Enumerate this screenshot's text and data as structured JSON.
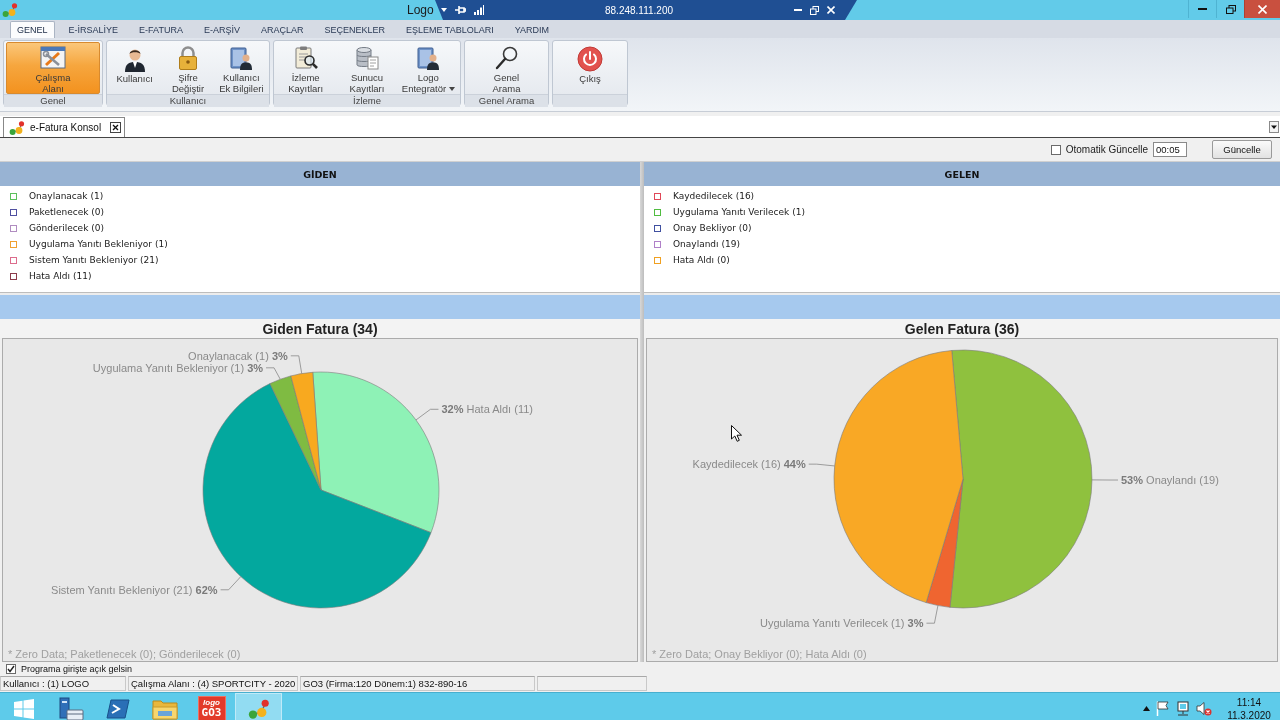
{
  "title_bar": {
    "title": "Logo"
  },
  "remote_bar": {
    "address": "88.248.111.200"
  },
  "ribbon": {
    "tabs": [
      {
        "label": "GENEL",
        "selected": true
      },
      {
        "label": "E-İRSALİYE",
        "selected": false
      },
      {
        "label": "E-FATURA",
        "selected": false
      },
      {
        "label": "E-ARŞİV",
        "selected": false
      },
      {
        "label": "ARAÇLAR",
        "selected": false
      },
      {
        "label": "SEÇENEKLER",
        "selected": false
      },
      {
        "label": "EŞLEME TABLOLARI",
        "selected": false
      },
      {
        "label": "YARDIM",
        "selected": false
      }
    ],
    "groups": [
      {
        "label": "Genel",
        "buttons": [
          {
            "lines": [
              "Çalışma",
              "Alanı"
            ],
            "selected": true,
            "dropdown": false
          }
        ]
      },
      {
        "label": "Kullanıcı",
        "buttons": [
          {
            "lines": [
              "Kullanıcı"
            ],
            "selected": false,
            "dropdown": false
          },
          {
            "lines": [
              "Şifre",
              "Değiştir"
            ],
            "selected": false,
            "dropdown": false
          },
          {
            "lines": [
              "Kullanıcı",
              "Ek Bilgileri"
            ],
            "selected": false,
            "dropdown": false
          }
        ]
      },
      {
        "label": "İzleme",
        "buttons": [
          {
            "lines": [
              "İzleme",
              "Kayıtları"
            ],
            "selected": false,
            "dropdown": false
          },
          {
            "lines": [
              "Sunucu",
              "Kayıtları"
            ],
            "selected": false,
            "dropdown": false
          },
          {
            "lines": [
              "Logo",
              "Entegratör"
            ],
            "selected": false,
            "dropdown": true
          }
        ]
      },
      {
        "label": "Genel Arama",
        "buttons": [
          {
            "lines": [
              "Genel",
              "Arama"
            ],
            "selected": false,
            "dropdown": false
          }
        ]
      },
      {
        "buttons": [
          {
            "lines": [
              "Çıkış"
            ],
            "selected": false,
            "dropdown": false
          }
        ]
      }
    ]
  },
  "document_tabs": [
    {
      "label": "e-Fatura Konsol",
      "selected": true
    }
  ],
  "toolbar": {
    "auto_update": {
      "label": "Otomatik Güncelle",
      "checked": false
    },
    "interval": {
      "value": "00:05"
    },
    "refresh_button": "Güncelle"
  },
  "panels": [
    {
      "header": "GİDEN",
      "items": [
        {
          "label": "Onaylanacak (1)",
          "color": "#5cc05c"
        },
        {
          "label": "Paketlenecek (0)",
          "color": "#5050a0"
        },
        {
          "label": "Gönderilecek (0)",
          "color": "#b08cc0"
        },
        {
          "label": "Uygulama Yanıtı Bekleniyor (1)",
          "color": "#f0a030"
        },
        {
          "label": "Sistem Yanıtı Bekleniyor (21)",
          "color": "#dc6c8c"
        },
        {
          "label": "Hata Aldı (11)",
          "color": "#8c3c4c"
        }
      ],
      "chart_data": {
        "type": "pie",
        "title": "Giden Fatura (34)",
        "categories": [
          "Hata Aldı (11)",
          "Sistem Yanıtı Bekleniyor (21)",
          "Uygulama Yanıtı Bekleniyor (1)",
          "Onaylanacak (1)"
        ],
        "values": [
          32,
          62,
          3,
          3
        ],
        "colors": [
          "#8ef2b6",
          "#03a89e",
          "#7fbb42",
          "#f8a91f"
        ],
        "value_labels": [
          "32%",
          "62%",
          "3%",
          "3%"
        ],
        "annotations": [
          "* Zero Data; Paketlenecek (0); Gönderilecek (0)"
        ]
      }
    },
    {
      "header": "GELEN",
      "items": [
        {
          "label": "Kaydedilecek (16)",
          "color": "#e04858"
        },
        {
          "label": "Uygulama Yanıtı Verilecek (1)",
          "color": "#50bc40"
        },
        {
          "label": "Onay Bekliyor (0)",
          "color": "#4050a0"
        },
        {
          "label": "Onaylandı (19)",
          "color": "#b080c8"
        },
        {
          "label": "Hata Aldı (0)",
          "color": "#f0a020"
        }
      ],
      "chart_data": {
        "type": "pie",
        "title": "Gelen Fatura (36)",
        "categories": [
          "Onaylandı (19)",
          "Uygulama Yanıtı Verilecek (1)",
          "Kaydedilecek (16)"
        ],
        "values": [
          53,
          3,
          44
        ],
        "colors": [
          "#8fc13e",
          "#ef6530",
          "#f9a825"
        ],
        "value_labels": [
          "53%",
          "3%",
          "44%"
        ],
        "annotations": [
          "* Zero Data; Onay Bekliyor (0); Hata Aldı (0)"
        ]
      }
    }
  ],
  "startup_option": {
    "label": "Programa girişte açık gelsin",
    "checked": true
  },
  "status_bar": [
    "Kullanıcı : (1) LOGO",
    "Çalışma Alanı : (4) SPORTCITY - 2020",
    "GO3 (Firma:120 Dönem:1) 832-890-16"
  ],
  "taskbar": {
    "apps": [
      {
        "kind": "start",
        "selected": false
      },
      {
        "kind": "tool",
        "selected": false
      },
      {
        "kind": "shell",
        "selected": false
      },
      {
        "kind": "folder",
        "selected": false
      },
      {
        "kind": "tile",
        "selected": false,
        "logo_text": "logo",
        "logo_subtext": "GO3"
      },
      {
        "kind": "app",
        "selected": true
      }
    ],
    "clock": {
      "time": "11:14",
      "date": "11.3.2020"
    }
  }
}
